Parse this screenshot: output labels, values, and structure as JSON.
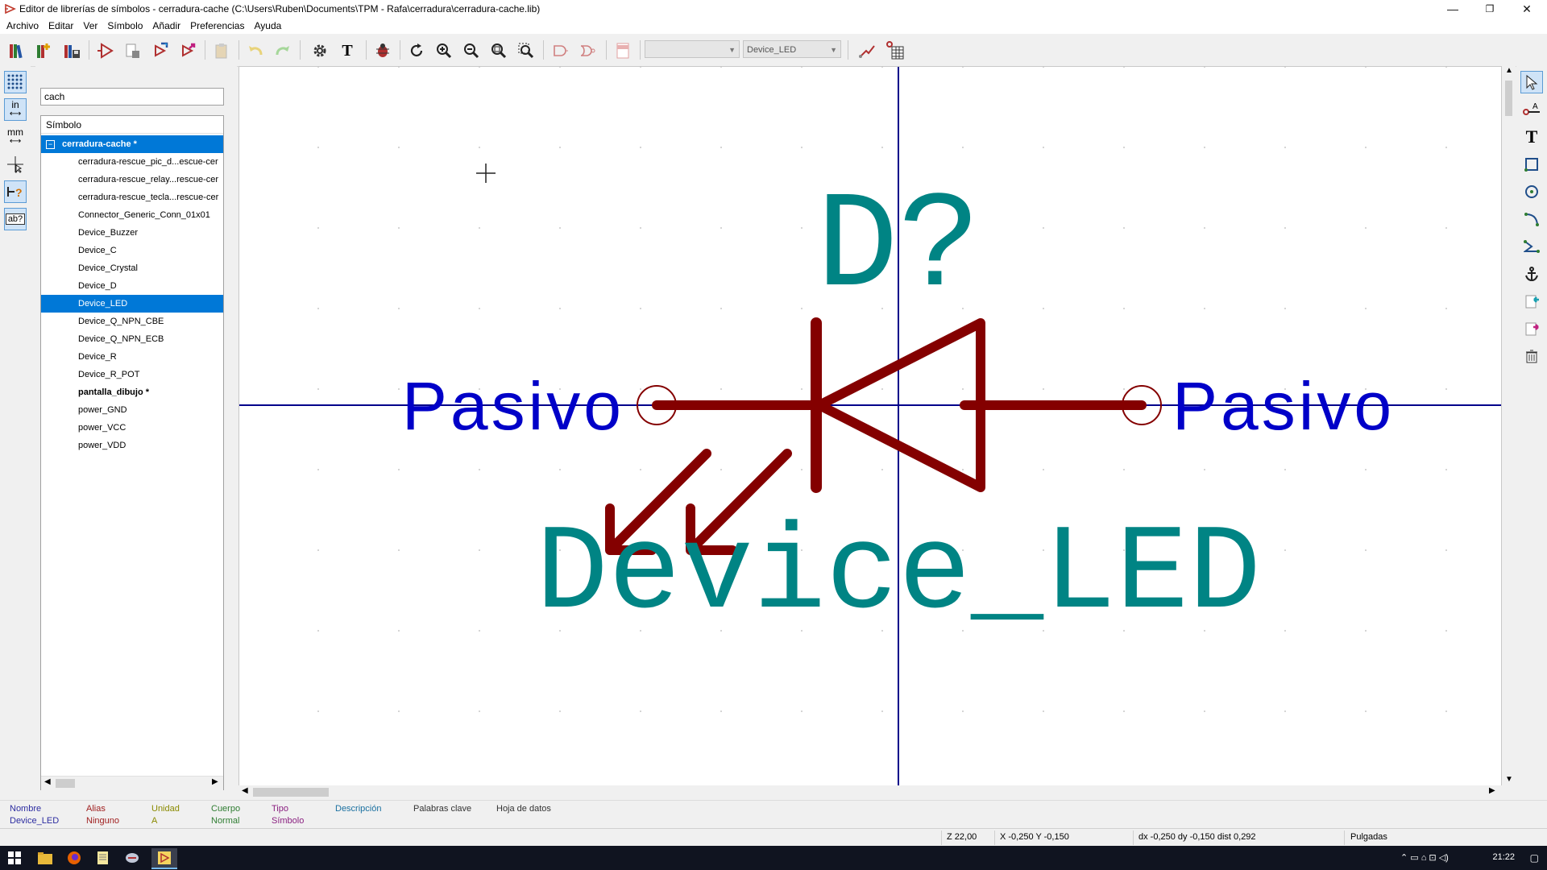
{
  "window": {
    "title": "Editor de librerías de símbolos - cerradura-cache (C:\\Users\\Ruben\\Documents\\TPM - Rafa\\cerradura\\cerradura-cache.lib)",
    "minimize": "—",
    "restore": "❐",
    "close": "✕"
  },
  "menu": [
    "Archivo",
    "Editar",
    "Ver",
    "Símbolo",
    "Añadir",
    "Preferencias",
    "Ayuda"
  ],
  "toolbar": {
    "unit_combo": "",
    "symbol_combo": "Device_LED"
  },
  "left_tools": {
    "units_in": "in",
    "units_mm": "mm",
    "pin_tooltip": "?",
    "text_tool": "ab?"
  },
  "library": {
    "search_value": "cach",
    "header": "Símbolo",
    "items": [
      {
        "label": "cerradura-cache *",
        "kind": "library",
        "selected": true
      },
      {
        "label": "cerradura-rescue_pic_d...escue-cer",
        "kind": "symbol"
      },
      {
        "label": "cerradura-rescue_relay...rescue-cer",
        "kind": "symbol"
      },
      {
        "label": "cerradura-rescue_tecla...rescue-cer",
        "kind": "symbol"
      },
      {
        "label": "Connector_Generic_Conn_01x01",
        "kind": "symbol"
      },
      {
        "label": "Device_Buzzer",
        "kind": "symbol"
      },
      {
        "label": "Device_C",
        "kind": "symbol"
      },
      {
        "label": "Device_Crystal",
        "kind": "symbol"
      },
      {
        "label": "Device_D",
        "kind": "symbol"
      },
      {
        "label": "Device_LED",
        "kind": "symbol",
        "selected": true
      },
      {
        "label": "Device_Q_NPN_CBE",
        "kind": "symbol"
      },
      {
        "label": "Device_Q_NPN_ECB",
        "kind": "symbol"
      },
      {
        "label": "Device_R",
        "kind": "symbol"
      },
      {
        "label": "Device_R_POT",
        "kind": "symbol"
      },
      {
        "label": "pantalla_dibujo *",
        "kind": "library"
      },
      {
        "label": "power_GND",
        "kind": "symbol"
      },
      {
        "label": "power_VCC",
        "kind": "symbol"
      },
      {
        "label": "power_VDD",
        "kind": "symbol"
      }
    ]
  },
  "canvas": {
    "reference": "D?",
    "value": "Device_LED",
    "pin_left_type": "Pasivo",
    "pin_right_type": "Pasivo",
    "colors": {
      "body": "#840000",
      "field": "#008484",
      "pin_text": "#0000c8",
      "axis": "#00008a"
    }
  },
  "info": {
    "nombre_label": "Nombre",
    "nombre": "Device_LED",
    "alias_label": "Alias",
    "alias": "Ninguno",
    "unidad_label": "Unidad",
    "unidad": "A",
    "cuerpo_label": "Cuerpo",
    "cuerpo": "Normal",
    "tipo_label": "Tipo",
    "tipo": "Símbolo",
    "descripcion_label": "Descripción",
    "palabras_label": "Palabras clave",
    "hoja_label": "Hoja de datos"
  },
  "status": {
    "zoom": "Z 22,00",
    "xy": "X -0,250  Y -0,150",
    "delta": "dx -0,250  dy -0,150  dist 0,292",
    "units": "Pulgadas"
  },
  "taskbar": {
    "clock": "21:22"
  }
}
